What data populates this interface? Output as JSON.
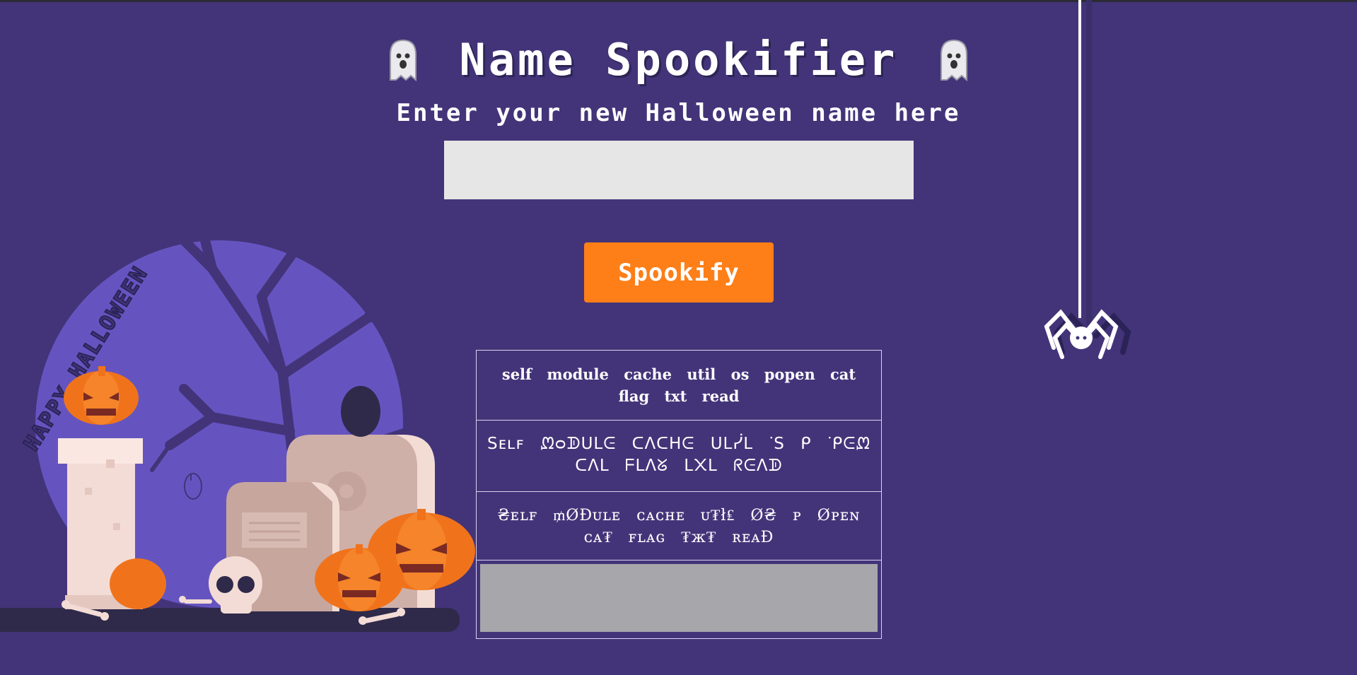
{
  "header": {
    "title": "Name Spookifier",
    "left_icon": "ghost-icon",
    "right_icon": "ghost-icon"
  },
  "form": {
    "subtitle": "Enter your new Halloween name here",
    "input_value": "",
    "submit_label": "Spookify"
  },
  "results": [
    "self module cache util os popen cat flag txt read",
    "Ѕᴇʟꜰ ᘻᴑᗫᑌᒪᕮ ᑕᐱᑕᕼᕮ ᑌᒪᓰᒪ ᐝЅ ᑭ ᐝᑭᕮᘻ ᑕᐱᒪ ᖴᒪᐱᘜ ᒪ᙭ᒪ ᖇᕮᐱᗫ",
    "₴ᴇʟꜰ ₥ØĐᴜʟᴇ ᴄᴀᴄʜᴇ ᴜ₮ł₤ Ø₴ ᴘ Øᴘᴇɴ ᴄᴀ₮ ꜰʟᴀɢ ₮ж₮ ʀᴇᴀĐ",
    ""
  ],
  "decor": {
    "banner_text": "HAPPY HALLOWEEN",
    "spider_icon": "spider-icon"
  },
  "colors": {
    "background": "#433479",
    "button": "#fe7e17",
    "input": "#e6e6e6"
  }
}
